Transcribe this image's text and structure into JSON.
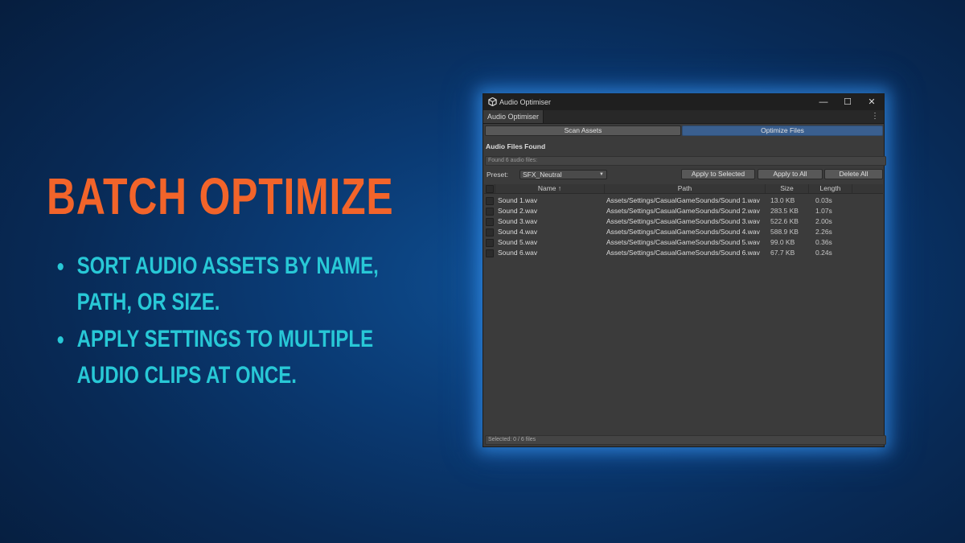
{
  "promo": {
    "headline": "BATCH OPTIMIZE",
    "bullets": [
      "SORT AUDIO ASSETS BY NAME, PATH, OR SIZE.",
      "APPLY SETTINGS TO MULTIPLE AUDIO CLIPS AT ONCE."
    ]
  },
  "window": {
    "title": "Audio Optimiser",
    "tab_label": "Audio Optimiser",
    "controls": {
      "minimize": "—",
      "maximize": "☐",
      "close": "✕"
    },
    "kebab": "⋮",
    "scan_button": "Scan Assets",
    "optimize_button": "Optimize Files",
    "section_title": "Audio Files Found",
    "status_text": "Found 6 audio files:",
    "preset_label": "Preset:",
    "preset_value": "SFX_Neutral",
    "apply_selected": "Apply to Selected",
    "apply_all": "Apply to All",
    "delete_all": "Delete All",
    "columns": {
      "name": "Name ↑",
      "path": "Path",
      "size": "Size",
      "length": "Length"
    },
    "rows": [
      {
        "name": "Sound 1.wav",
        "path": "Assets/Settings/CasualGameSounds/Sound 1.wav",
        "size": "13.0 KB",
        "length": "0.03s"
      },
      {
        "name": "Sound 2.wav",
        "path": "Assets/Settings/CasualGameSounds/Sound 2.wav",
        "size": "283.5 KB",
        "length": "1.07s"
      },
      {
        "name": "Sound 3.wav",
        "path": "Assets/Settings/CasualGameSounds/Sound 3.wav",
        "size": "522.6 KB",
        "length": "2.00s"
      },
      {
        "name": "Sound 4.wav",
        "path": "Assets/Settings/CasualGameSounds/Sound 4.wav",
        "size": "588.9 KB",
        "length": "2.26s"
      },
      {
        "name": "Sound 5.wav",
        "path": "Assets/Settings/CasualGameSounds/Sound 5.wav",
        "size": "99.0 KB",
        "length": "0.36s"
      },
      {
        "name": "Sound 6.wav",
        "path": "Assets/Settings/CasualGameSounds/Sound 6.wav",
        "size": "67.7 KB",
        "length": "0.24s"
      }
    ],
    "footer": "Selected: 0 / 6 files"
  },
  "colors": {
    "headline": "#f2642a",
    "bullets": "#28c8d6",
    "primary_button": "#3a5f8f",
    "glow": "#3ca0ff"
  }
}
